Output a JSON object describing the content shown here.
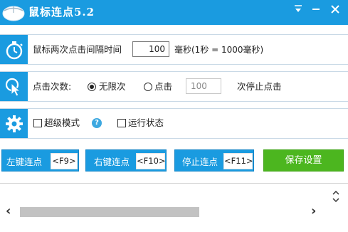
{
  "window": {
    "title": "鼠标连点5.2",
    "icons": {
      "app": "mouse-icon",
      "menu": "menu-arrow-icon",
      "minimize": "minimize-icon",
      "close": "close-icon"
    }
  },
  "interval_row": {
    "icon": "stopwatch-icon",
    "label": "鼠标两次点击间隔时间",
    "value": "100",
    "unit": "毫秒(1秒 = 1000毫秒)"
  },
  "count_row": {
    "icon": "cursor-click-icon",
    "label": "点击次数:",
    "unlimited_label": "无限次",
    "limited_label": "点击",
    "count_value": "100",
    "after_label": "次停止点击",
    "unlimited_selected": true
  },
  "mode_row": {
    "icon": "gear-icon",
    "super_mode_label": "超级模式",
    "help_icon": "help-icon",
    "help_glyph": "?",
    "run_state_label": "运行状态"
  },
  "buttons": {
    "left_click": {
      "label": "左键连点",
      "key": "<F9>"
    },
    "right_click": {
      "label": "右键连点",
      "key": "<F10>"
    },
    "stop": {
      "label": "停止连点",
      "key": "<F11>"
    },
    "save": {
      "label": "保存设置"
    }
  },
  "scroll": {
    "left_arrow": "‹",
    "right_arrow": "›",
    "up_down_icon": "chevron-up-down-icon"
  },
  "colors": {
    "accent": "#1a9be0",
    "save": "#4cb61f"
  }
}
